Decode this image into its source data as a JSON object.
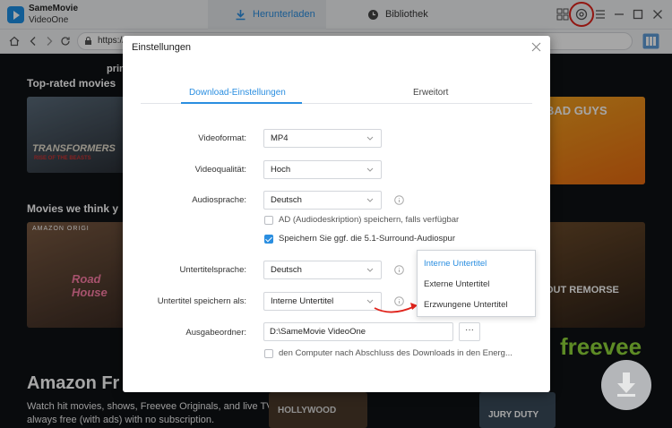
{
  "app": {
    "name": "SameMovie",
    "subtitle": "VideoOne",
    "accent": "#2a8ee0"
  },
  "nav": {
    "download_tab": "Herunterladen",
    "library_tab": "Bibliothek"
  },
  "browser": {
    "url": "https://"
  },
  "background": {
    "text_prime": "prime",
    "section_top_rated": "Top-rated movies",
    "section_we_think": "Movies we think y",
    "poster_transformers": "TRANSFORMERS",
    "poster_transformers_sub": "RISE OF THE BEASTS",
    "poster_bad_guys": "BAD GUYS",
    "poster_amazon_orig": "AMAZON ORIGI",
    "poster_road_house": "Road House",
    "poster_out_remorse": "OUT REMORSE",
    "freevee_logo": "freevee",
    "amazon_freevee_title": "Amazon Fr",
    "amazon_freevee_desc1": "Watch hit movies, shows, Freevee Originals, and live TV,",
    "amazon_freevee_desc2": "always free (with ads) with no subscription.",
    "poster_hollywood": "HOLLYWOOD",
    "poster_jury_duty": "JURY DUTY"
  },
  "modal": {
    "title": "Einstellungen",
    "tabs": [
      "Download-Einstellungen",
      "Erweitort"
    ],
    "fields": {
      "video_format": {
        "label": "Videoformat:",
        "value": "MP4"
      },
      "video_quality": {
        "label": "Videoqualität:",
        "value": "Hoch"
      },
      "audio_language": {
        "label": "Audiosprache:",
        "value": "Deutsch"
      },
      "ad_checkbox": "AD (Audiodeskription) speichern, falls verfügbar",
      "surround_checkbox": "Speichern Sie ggf. die 5.1-Surround-Audiospur",
      "subtitle_language": {
        "label": "Untertitelsprache:",
        "value": "Deutsch"
      },
      "subtitle_save_as": {
        "label": "Untertitel speichern als:",
        "value": "Interne Untertitel"
      },
      "output_folder": {
        "label": "Ausgabeordner:",
        "value": "D:\\SameMovie VideoOne"
      },
      "more_button": "···",
      "shutdown_checkbox": "den Computer nach Abschluss des Downloads in den Energ..."
    }
  },
  "subtitle_dropdown": {
    "options": [
      "Interne Untertitel",
      "Externe Untertitel",
      "Erzwungene Untertitel"
    ],
    "selected_index": 0
  }
}
